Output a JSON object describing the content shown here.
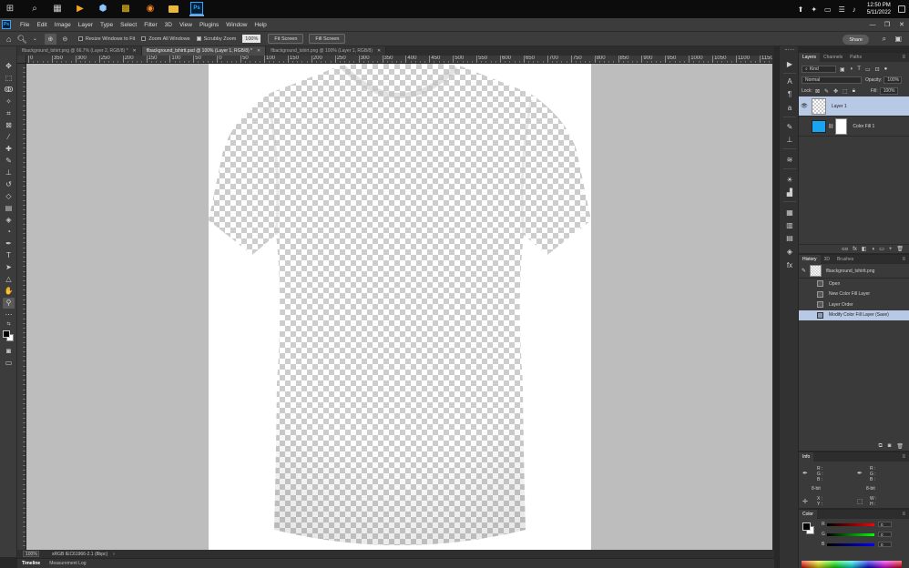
{
  "taskbar": {
    "icons": [
      {
        "name": "windows-icon",
        "glyph": "⊞"
      },
      {
        "name": "search-icon",
        "glyph": "⌕"
      },
      {
        "name": "film-icon",
        "glyph": "▦"
      },
      {
        "name": "media-player-icon",
        "glyph": "▶"
      },
      {
        "name": "cube-3d-icon",
        "glyph": "⬢"
      },
      {
        "name": "app-grid-icon",
        "glyph": "▩"
      },
      {
        "name": "firefox-icon",
        "glyph": "◉"
      },
      {
        "name": "folder-icon",
        "glyph": ""
      },
      {
        "name": "photoshop-icon",
        "glyph": "Ps"
      }
    ],
    "tray_icons": [
      "⬆",
      "✦",
      "▭",
      "☰",
      "♪"
    ],
    "time": "12:50 PM",
    "date": "5/11/2022"
  },
  "menubar": {
    "logo": "Ps",
    "items": [
      "File",
      "Edit",
      "Image",
      "Layer",
      "Type",
      "Select",
      "Filter",
      "3D",
      "View",
      "Plugins",
      "Window",
      "Help"
    ],
    "controls": [
      "—",
      "❐",
      "✕"
    ]
  },
  "options_bar": {
    "resize_windows": "Resize Windows to Fit",
    "zoom_all_windows": "Zoom All Windows",
    "scrubby_zoom": "Scrubby Zoom",
    "zoom_value": "100%",
    "fit_screen": "Fit Screen",
    "fill_screen": "Fill Screen",
    "share": "Share"
  },
  "doc_tabs": [
    {
      "label": "flbackground_tshirt.png @ 66.7% (Layer 2, RGB/8) *",
      "active": false
    },
    {
      "label": "flbackground_tshirtt.psd @ 100% (Layer 1, RGB/8) *",
      "active": true
    },
    {
      "label": "flbackground_tshirt.png @ 100% (Layer 1, RGB/8)",
      "active": false
    }
  ],
  "ruler": {
    "labels": [
      "0",
      "350",
      "300",
      "250",
      "200",
      "150",
      "100",
      "50",
      "0",
      "50",
      "100",
      "150",
      "200",
      "250",
      "300",
      "350",
      "400",
      "450",
      "500",
      "550",
      "600",
      "650",
      "700",
      "750",
      "800",
      "850",
      "900",
      "950",
      "1000",
      "1050",
      "1100",
      "1150"
    ]
  },
  "status": {
    "zoom": "100%",
    "doc_profile": "sRGB IEC61966-2.1 (8bpc)",
    "arrow": "›"
  },
  "bottom_tabs": [
    "Timeline",
    "Measurement Log"
  ],
  "layers_panel": {
    "tabs": [
      "Layers",
      "Channels",
      "Paths"
    ],
    "filter_kind": "Kind",
    "blend_mode": "Normal",
    "opacity_label": "Opacity:",
    "opacity_value": "100%",
    "lock_label": "Lock:",
    "fill_label": "Fill:",
    "fill_value": "100%",
    "layers": [
      {
        "name": "Layer 1",
        "selected": true
      },
      {
        "name": "Color Fill 1",
        "selected": false
      }
    ],
    "fill_color": "#1aa3f0",
    "footer_icons": [
      "GO",
      "fx",
      "◧",
      "◑",
      "▭",
      "+",
      "🗑"
    ]
  },
  "history_panel": {
    "tabs": [
      "History",
      "3D",
      "Brushes"
    ],
    "snapshot": "flbackground_tshirtt.png",
    "steps": [
      {
        "label": "Open",
        "selected": false
      },
      {
        "label": "New Color Fill Layer",
        "selected": false
      },
      {
        "label": "Layer Order",
        "selected": false
      },
      {
        "label": "Modify Color Fill Layer (Save)",
        "selected": true
      }
    ]
  },
  "info_panel": {
    "title": "Info",
    "left_channels": [
      "R :",
      "G :",
      "B :"
    ],
    "right_channels": [
      "R :",
      "G :",
      "B :"
    ],
    "bit_left": "8-bit",
    "bit_right": "8-bit",
    "xy": [
      "X :",
      "Y :"
    ],
    "wh": [
      "W :",
      "H :"
    ]
  },
  "color_panel": {
    "title": "Color",
    "r_label": "R",
    "g_label": "G",
    "b_label": "B",
    "r": "0",
    "g": "0",
    "b": "0"
  }
}
